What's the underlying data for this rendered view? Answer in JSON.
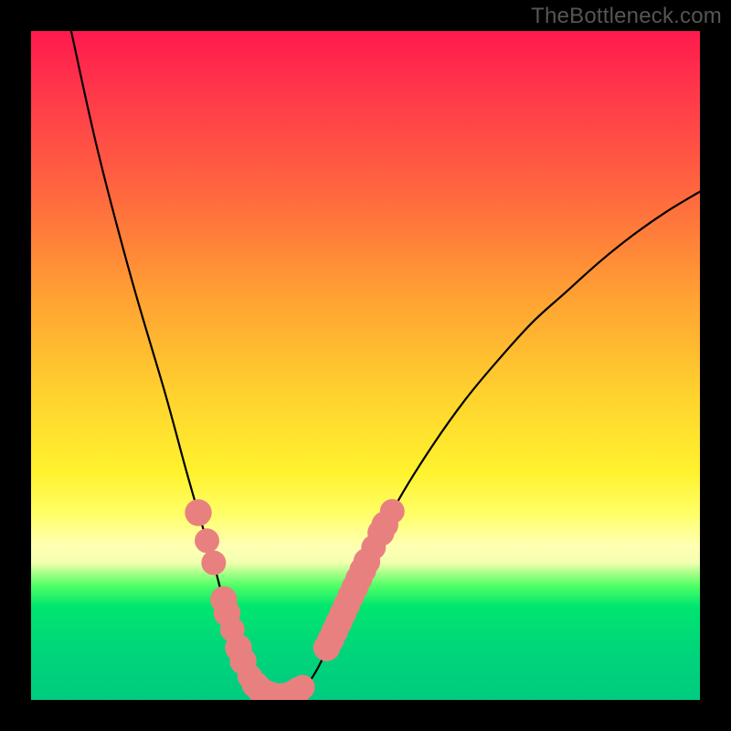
{
  "watermark": "TheBottleneck.com",
  "chart_data": {
    "type": "line",
    "title": "",
    "xlabel": "",
    "ylabel": "",
    "xlim": [
      0,
      100
    ],
    "ylim": [
      0,
      100
    ],
    "curve": {
      "name": "bottleneck-curve",
      "points": [
        {
          "x": 6.0,
          "y": 100.0
        },
        {
          "x": 10.0,
          "y": 82.0
        },
        {
          "x": 15.0,
          "y": 63.0
        },
        {
          "x": 20.0,
          "y": 46.0
        },
        {
          "x": 23.0,
          "y": 35.0
        },
        {
          "x": 25.0,
          "y": 28.0
        },
        {
          "x": 27.0,
          "y": 21.5
        },
        {
          "x": 29.0,
          "y": 14.0
        },
        {
          "x": 30.5,
          "y": 9.0
        },
        {
          "x": 32.0,
          "y": 5.0
        },
        {
          "x": 33.5,
          "y": 2.5
        },
        {
          "x": 35.0,
          "y": 1.0
        },
        {
          "x": 37.0,
          "y": 0.5
        },
        {
          "x": 39.0,
          "y": 0.8
        },
        {
          "x": 41.0,
          "y": 2.0
        },
        {
          "x": 43.0,
          "y": 5.0
        },
        {
          "x": 45.0,
          "y": 9.5
        },
        {
          "x": 47.0,
          "y": 14.0
        },
        {
          "x": 50.0,
          "y": 20.5
        },
        {
          "x": 55.0,
          "y": 30.0
        },
        {
          "x": 60.0,
          "y": 38.0
        },
        {
          "x": 65.0,
          "y": 45.0
        },
        {
          "x": 70.0,
          "y": 51.0
        },
        {
          "x": 75.0,
          "y": 56.5
        },
        {
          "x": 80.0,
          "y": 61.0
        },
        {
          "x": 85.0,
          "y": 65.5
        },
        {
          "x": 90.0,
          "y": 69.5
        },
        {
          "x": 95.0,
          "y": 73.0
        },
        {
          "x": 100.0,
          "y": 76.0
        }
      ]
    },
    "markers": {
      "name": "highlighted-points",
      "color": "#e98080",
      "points": [
        {
          "x": 25.0,
          "y": 28.0,
          "r": 1.4
        },
        {
          "x": 26.3,
          "y": 23.8,
          "r": 1.2
        },
        {
          "x": 27.3,
          "y": 20.5,
          "r": 1.2
        },
        {
          "x": 28.8,
          "y": 15.0,
          "r": 1.4
        },
        {
          "x": 29.3,
          "y": 13.0,
          "r": 1.4
        },
        {
          "x": 30.1,
          "y": 10.5,
          "r": 1.2
        },
        {
          "x": 31.0,
          "y": 7.8,
          "r": 1.4
        },
        {
          "x": 31.7,
          "y": 5.8,
          "r": 1.4
        },
        {
          "x": 32.7,
          "y": 3.5,
          "r": 1.2
        },
        {
          "x": 33.5,
          "y": 2.3,
          "r": 1.4
        },
        {
          "x": 34.3,
          "y": 1.5,
          "r": 1.4
        },
        {
          "x": 35.1,
          "y": 1.0,
          "r": 1.4
        },
        {
          "x": 35.9,
          "y": 0.7,
          "r": 1.4
        },
        {
          "x": 36.7,
          "y": 0.5,
          "r": 1.4
        },
        {
          "x": 37.5,
          "y": 0.5,
          "r": 1.4
        },
        {
          "x": 38.3,
          "y": 0.6,
          "r": 1.4
        },
        {
          "x": 39.1,
          "y": 0.9,
          "r": 1.4
        },
        {
          "x": 39.9,
          "y": 1.4,
          "r": 1.4
        },
        {
          "x": 40.6,
          "y": 1.9,
          "r": 1.2
        },
        {
          "x": 44.2,
          "y": 7.8,
          "r": 1.4
        },
        {
          "x": 44.8,
          "y": 9.0,
          "r": 1.4
        },
        {
          "x": 45.4,
          "y": 10.3,
          "r": 1.4
        },
        {
          "x": 46.0,
          "y": 11.6,
          "r": 1.4
        },
        {
          "x": 46.6,
          "y": 12.9,
          "r": 1.4
        },
        {
          "x": 47.2,
          "y": 14.2,
          "r": 1.4
        },
        {
          "x": 47.8,
          "y": 15.5,
          "r": 1.4
        },
        {
          "x": 48.4,
          "y": 16.8,
          "r": 1.4
        },
        {
          "x": 49.0,
          "y": 18.1,
          "r": 1.4
        },
        {
          "x": 49.6,
          "y": 19.4,
          "r": 1.4
        },
        {
          "x": 50.2,
          "y": 20.7,
          "r": 1.4
        },
        {
          "x": 51.2,
          "y": 22.8,
          "r": 1.2
        },
        {
          "x": 52.3,
          "y": 25.0,
          "r": 1.4
        },
        {
          "x": 52.9,
          "y": 26.2,
          "r": 1.4
        },
        {
          "x": 54.0,
          "y": 28.2,
          "r": 1.2
        }
      ]
    }
  }
}
